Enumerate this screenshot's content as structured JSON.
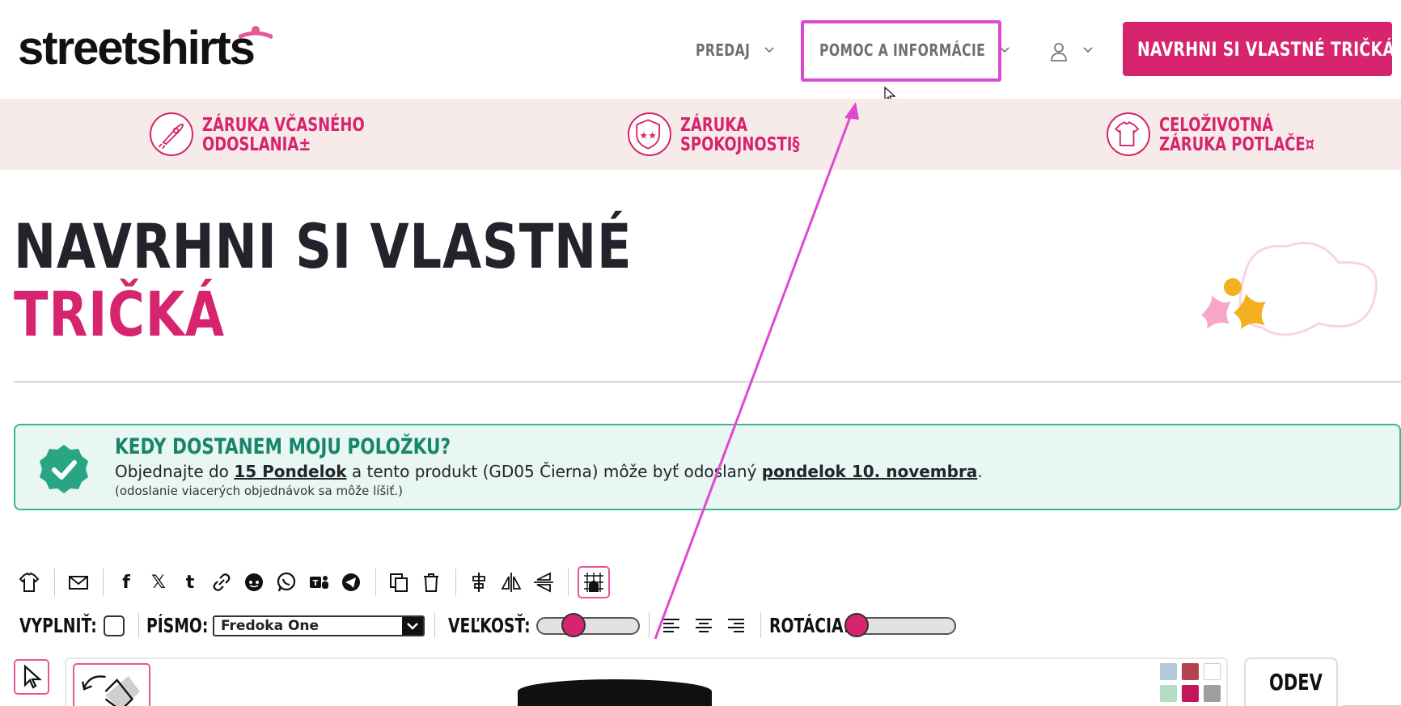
{
  "header": {
    "logo_text": "streetshirts",
    "nav": [
      {
        "label": "PREDAJ"
      },
      {
        "label": "POMOC A INFORMÁCIE"
      }
    ],
    "cta_label": "NAVRHNI SI VLASTNÉ TRIČKÁ"
  },
  "guarantees": [
    {
      "line1": "ZÁRUKA VČASNÉHO",
      "line2": "ODOSLANIA±"
    },
    {
      "line1": "ZÁRUKA",
      "line2": "SPOKOJNOSTI§"
    },
    {
      "line1": "CELOŽIVOTNÁ",
      "line2": "ZÁRUKA POTLAČE¤"
    }
  ],
  "page": {
    "title_line1": "NAVRHNI SI VLASTNÉ",
    "title_line2": "TRIČKÁ"
  },
  "notice": {
    "title": "KEDY DOSTANEM MOJU POLOŽKU?",
    "text_before": "Objednajte do ",
    "deadline": "15 Pondelok",
    "text_middle": " a tento produkt (GD05 Čierna) môže byť odoslaný ",
    "ship_date": "pondelok 10. novembra",
    "text_end": ".",
    "small": "(odoslanie viacerých objednávok sa môže líšiť.)"
  },
  "toolbar": {
    "fill_label": "VYPLNIŤ:",
    "font_label": "PÍSMO:",
    "font_value": "Fredoka One",
    "size_label": "VEĽKOSŤ:",
    "size_value": 0.28,
    "rotation_label": "ROTÁCIA:",
    "rotation_value": 0.0
  },
  "side_tab": {
    "label": "ODEV"
  },
  "swatches": [
    "#b3c8dd",
    "#b5414f",
    "#ffffff",
    "#b5dcc4",
    "#c2185b",
    "#9e9e9e"
  ],
  "colors": {
    "brand_pink": "#d6246e",
    "highlight": "#dd4ad0",
    "band_bg": "#f7ebea",
    "notice_green": "#17856b"
  }
}
